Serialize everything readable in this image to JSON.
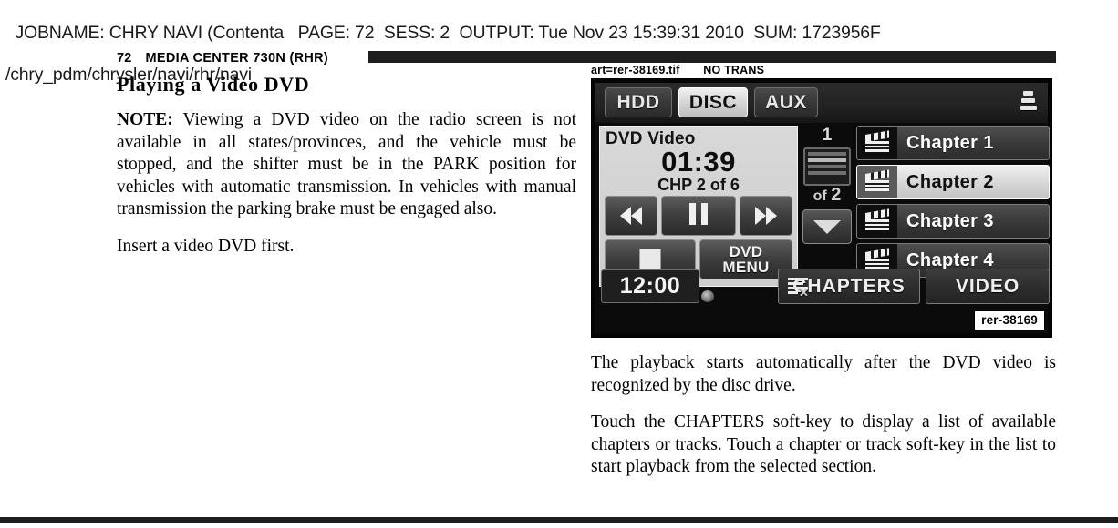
{
  "job_header": {
    "line1": "JOBNAME: CHRY NAVI (Contenta   PAGE: 72  SESS: 2  OUTPUT: Tue Nov 23 15:39:31 2010  SUM: 1723956F",
    "line2": "/chry_pdm/chrysler/navi/rhr/navi"
  },
  "running_head": {
    "page_number": "72",
    "title": "MEDIA CENTER 730N (RHR)"
  },
  "left_column": {
    "section_heading": "Playing a Video DVD",
    "note_lead": "NOTE:",
    "note_body": "Viewing a DVD video on the radio screen is not available in all states/provinces, and the vehicle must be stopped, and the shifter must be in the PARK position for vehicles with automatic transmission. In vehicles with manual transmission the parking brake must be engaged also.",
    "paragraph_2": "Insert a video DVD first."
  },
  "art": {
    "tag_line": "art=rer-38169.tif       NO TRANS",
    "figure_number": "rer-38169"
  },
  "radio_screen": {
    "source_tabs": [
      {
        "label": "HDD",
        "selected": false,
        "name": "tab-hdd"
      },
      {
        "label": "DISC",
        "selected": true,
        "name": "tab-disc"
      },
      {
        "label": "AUX",
        "selected": false,
        "name": "tab-aux"
      }
    ],
    "stack_icon": "layers-icon",
    "dvd_panel": {
      "media_label": "DVD Video",
      "elapsed_time": "01:39",
      "chapter_status": "CHP 2 of 6",
      "transport": {
        "rewind": "rewind-icon",
        "pause": "pause-icon",
        "fast_forward": "fast-forward-icon",
        "stop": "stop-icon",
        "dvd_menu_line1": "DVD",
        "dvd_menu_line2": "MENU"
      }
    },
    "pager": {
      "current_page": "1",
      "of_label": "of",
      "total_pages": "2",
      "down_arrow": "chevron-down-icon"
    },
    "chapter_list": [
      {
        "label": "Chapter 1",
        "selected": false
      },
      {
        "label": "Chapter 2",
        "selected": true
      },
      {
        "label": "Chapter 3",
        "selected": false
      },
      {
        "label": "Chapter 4",
        "selected": false
      }
    ],
    "soft_bar": {
      "clock": "12:00",
      "chapters_key": "CHAPTERS",
      "video_key": "VIDEO"
    }
  },
  "right_column": {
    "paragraph_1": "The playback starts automatically after the DVD video is recognized by the disc drive.",
    "paragraph_2": "Touch the CHAPTERS soft-key to display a list of available chapters or tracks. Touch a chapter or track soft-key in the list to start playback from the selected section."
  }
}
